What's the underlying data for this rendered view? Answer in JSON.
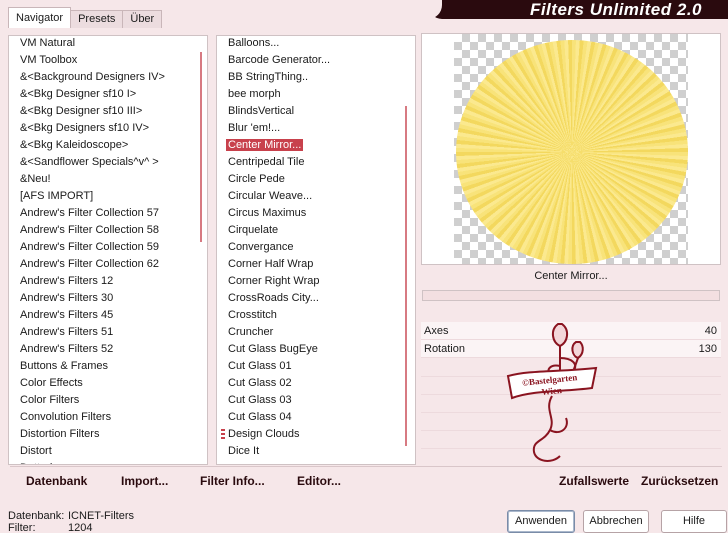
{
  "app_title": "Filters Unlimited 2.0",
  "tabs": [
    "Navigator",
    "Presets",
    "Über"
  ],
  "navigator_items": [
    "VM Natural",
    "VM Toolbox",
    "&<Background Designers IV>",
    "&<Bkg Designer sf10 I>",
    "&<Bkg Designer sf10 III>",
    "&<Bkg Designers sf10 IV>",
    "&<Bkg Kaleidoscope>",
    "&<Sandflower Specials^v^ >",
    "&Neu!",
    "[AFS IMPORT]",
    "Andrew's Filter Collection 57",
    "Andrew's Filter Collection 58",
    "Andrew's Filter Collection 59",
    "Andrew's Filter Collection 62",
    "Andrew's Filters 12",
    "Andrew's Filters 30",
    "Andrew's Filters 45",
    "Andrew's Filters 51",
    "Andrew's Filters 52",
    "Buttons & Frames",
    "Color Effects",
    "Color Filters",
    "Convolution Filters",
    "Distortion Filters",
    "Distort",
    "Dotted..."
  ],
  "filter_items": [
    "Balloons...",
    "Barcode Generator...",
    "BB StringThing..",
    "bee morph",
    "BlindsVertical",
    "Blur 'em!...",
    "Center Mirror...",
    "Centripedal Tile",
    "Circle Pede",
    "Circular Weave...",
    "Circus Maximus",
    "Cirquelate",
    "Convergance",
    "Corner Half Wrap",
    "Corner Right Wrap",
    "CrossRoads City...",
    "Crosstitch",
    "Cruncher",
    "Cut Glass  BugEye",
    "Cut Glass 01",
    "Cut Glass 02",
    "Cut Glass 03",
    "Cut Glass 04",
    "Design Clouds",
    "Dice It"
  ],
  "selected_filter_index": 6,
  "preview_label": "Center Mirror...",
  "params": [
    {
      "name": "Axes",
      "value": "40"
    },
    {
      "name": "Rotation",
      "value": "130"
    }
  ],
  "watermark_text": "©Bastelgarten Wien",
  "toolbar": {
    "datenbank": "Datenbank",
    "import": "Import...",
    "filter_info": "Filter Info...",
    "editor": "Editor...",
    "random": "Zufallswerte",
    "reset": "Zurücksetzen"
  },
  "status": {
    "db_label": "Datenbank:",
    "db_value": "ICNET-Filters",
    "filter_label": "Filter:",
    "filter_value": "1204"
  },
  "buttons": {
    "apply": "Anwenden",
    "cancel": "Abbrechen",
    "help": "Hilfe"
  },
  "colors": {
    "accent": "#c8414c",
    "banner": "#2a0a0e",
    "background": "#f6e7e9"
  }
}
